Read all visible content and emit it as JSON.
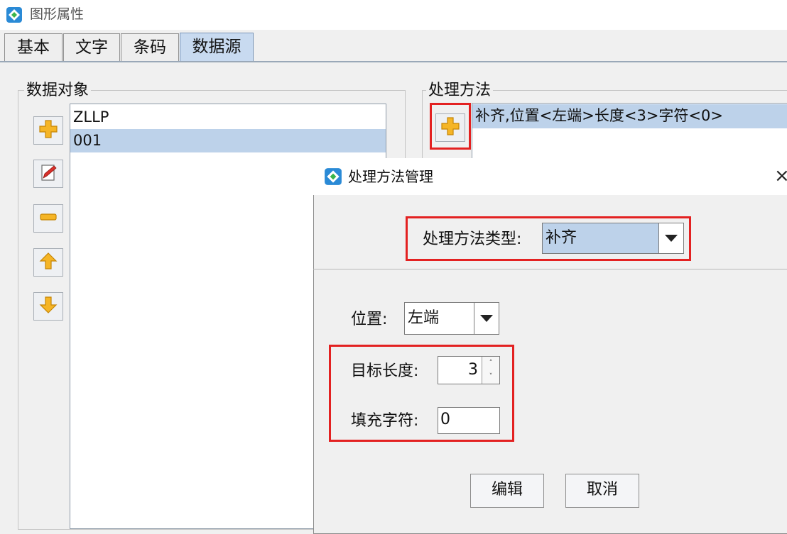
{
  "window": {
    "title": "图形属性",
    "icon": "app-diamond-icon"
  },
  "tabs": [
    {
      "label": "基本"
    },
    {
      "label": "文字"
    },
    {
      "label": "条码"
    },
    {
      "label": "数据源"
    }
  ],
  "active_tab": "数据源",
  "data_objects": {
    "label": "数据对象",
    "items": [
      "ZLLP",
      "001"
    ],
    "selected_index": 1,
    "buttons": [
      "add-icon",
      "edit-icon",
      "remove-icon",
      "up-arrow-icon",
      "down-arrow-icon"
    ]
  },
  "process_methods": {
    "label": "处理方法",
    "items": [
      "补齐,位置<左端>长度<3>字符<0>"
    ],
    "add_icon": "add-icon"
  },
  "dialog": {
    "title": "处理方法管理",
    "close": "×",
    "type_label": "处理方法类型:",
    "type_value": "补齐",
    "position_label": "位置:",
    "position_value": "左端",
    "length_label": "目标长度:",
    "length_value": "3",
    "fill_label": "填充字符:",
    "fill_value": "0",
    "edit_button": "编辑",
    "cancel_button": "取消",
    "spin_up": "˄",
    "spin_down": "˅"
  },
  "colors": {
    "highlight": "#e32121",
    "selection": "#bdd2ea",
    "active_tab": "#c8daf0"
  }
}
